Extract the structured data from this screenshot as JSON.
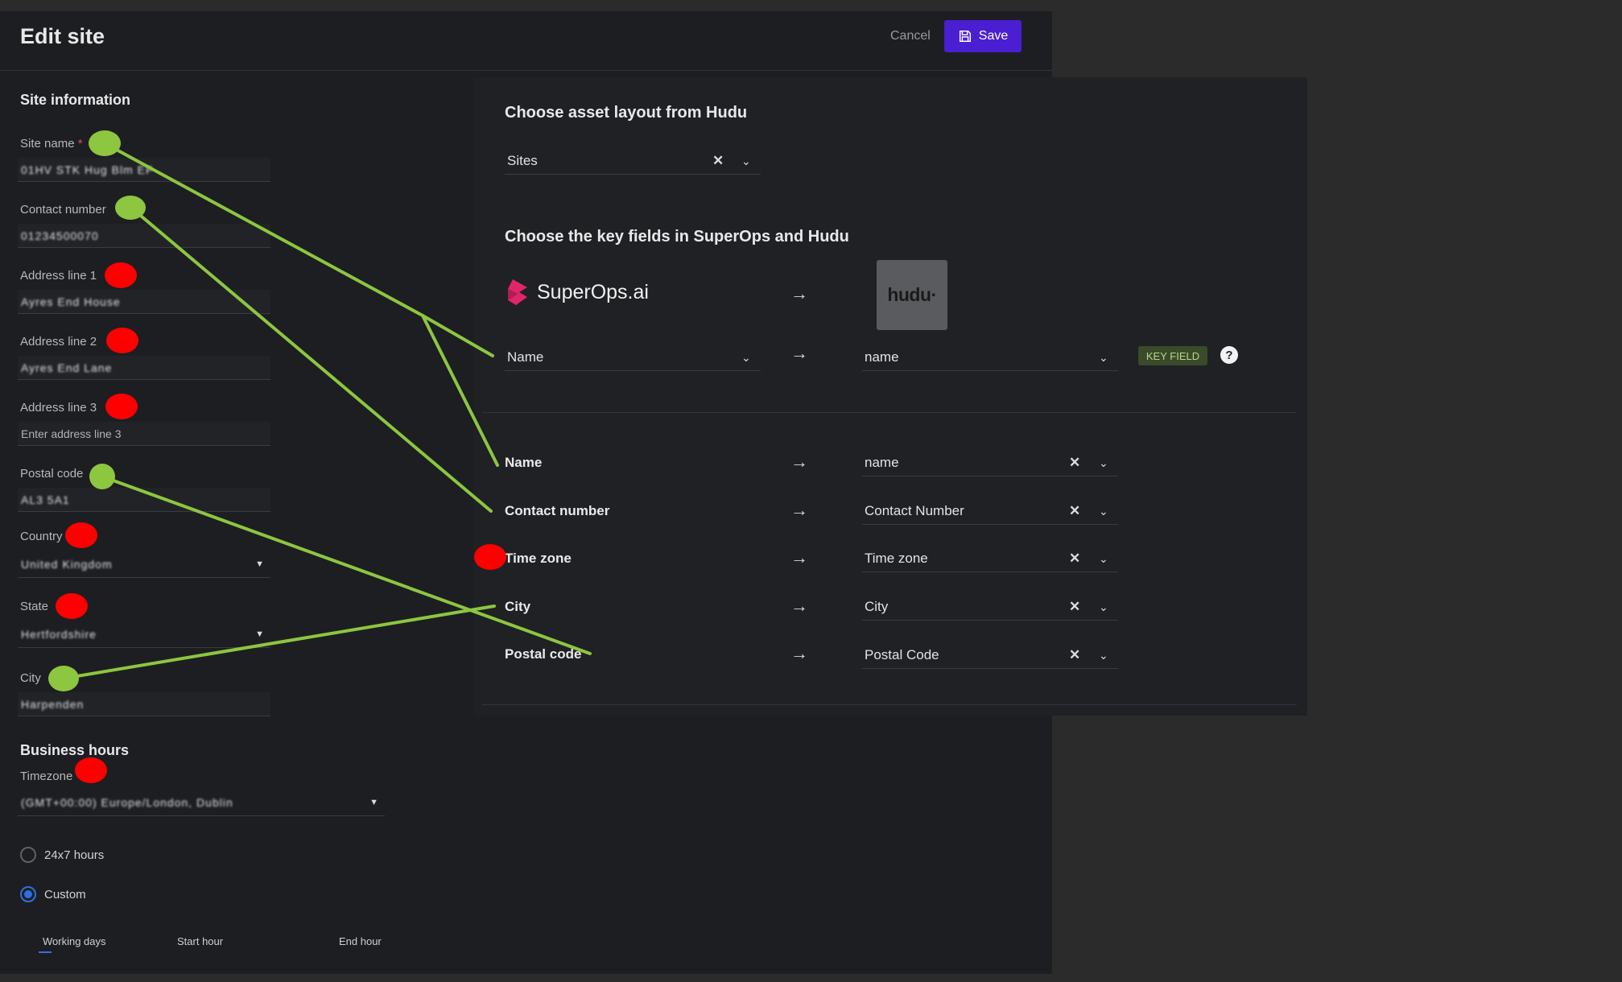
{
  "edit_site": {
    "title": "Edit site",
    "cancel_label": "Cancel",
    "save_label": "Save",
    "site_information": {
      "heading": "Site information",
      "site_name_label": "Site name",
      "required_mark": "*",
      "site_name_value": "01HV  STK  Hug  Blm  EF",
      "contact_number_label": "Contact number",
      "contact_number_value": "01234500070",
      "address_line1_label": "Address line 1",
      "address_line1_value": "Ayres End House",
      "address_line2_label": "Address line 2",
      "address_line2_value": "Ayres End Lane",
      "address_line3_label": "Address line 3",
      "address_line3_placeholder": "Enter address line 3",
      "postal_code_label": "Postal code",
      "postal_code_value": "AL3 5A1",
      "country_label": "Country",
      "country_value": "United Kingdom",
      "state_label": "State",
      "state_value": "Hertfordshire",
      "city_label": "City",
      "city_value": "Harpenden"
    },
    "business_hours": {
      "heading": "Business hours",
      "timezone_label": "Timezone",
      "timezone_value": "(GMT+00:00) Europe/London, Dublin",
      "option_247": "24x7 hours",
      "option_custom": "Custom",
      "columns": [
        "Working days",
        "Start hour",
        "End hour"
      ]
    }
  },
  "hudu": {
    "layout_title": "Choose asset layout from Hudu",
    "layout_value": "Sites",
    "key_fields_title": "Choose the key fields in SuperOps and Hudu",
    "superops_logo_text": "SuperOps.ai",
    "hudu_logo_text": "hudu·",
    "key_field": {
      "left": "Name",
      "right": "name",
      "badge": "KEY FIELD",
      "help": "?"
    },
    "mappings": [
      {
        "left": "Name",
        "right": "name"
      },
      {
        "left": "Contact number",
        "right": "Contact Number"
      },
      {
        "left": "Time zone",
        "right": "Time zone"
      },
      {
        "left": "City",
        "right": "City"
      },
      {
        "left": "Postal code",
        "right": "Postal Code"
      }
    ]
  },
  "colors": {
    "accent": "#4a1fd1",
    "annotation_mapped": "#8dc63f",
    "annotation_unmapped": "#ff0000",
    "keyfield_badge": "#3a4a2a"
  },
  "icons": [
    "save-icon",
    "clear-icon",
    "chevron-down-icon",
    "arrow-right-icon",
    "help-icon",
    "superops-logo",
    "hudu-logo"
  ]
}
